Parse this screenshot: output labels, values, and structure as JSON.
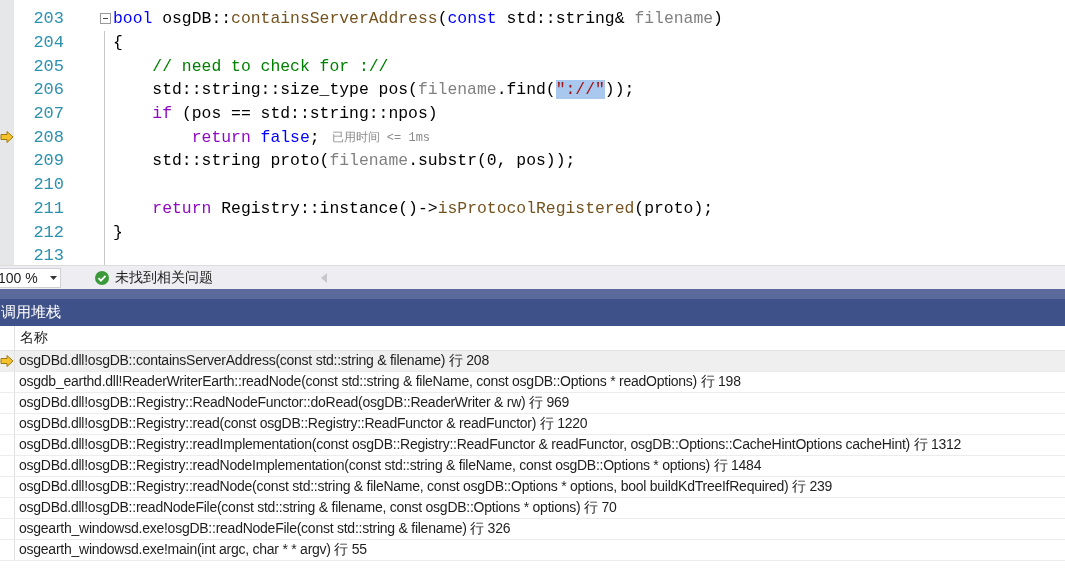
{
  "editor": {
    "lines": [
      {
        "number": "203",
        "current": false,
        "fold": true,
        "tokens": [
          {
            "kind": "kw",
            "text": "bool"
          },
          {
            "kind": "plain",
            "text": " osgDB::"
          },
          {
            "kind": "func",
            "text": "containsServerAddress"
          },
          {
            "kind": "plain",
            "text": "("
          },
          {
            "kind": "kw",
            "text": "const"
          },
          {
            "kind": "plain",
            "text": " std::string& "
          },
          {
            "kind": "param",
            "text": "filename"
          },
          {
            "kind": "plain",
            "text": ")"
          }
        ]
      },
      {
        "number": "204",
        "current": false,
        "tokens": [
          {
            "kind": "plain",
            "text": "{"
          }
        ]
      },
      {
        "children": [
          {
            "number": "205",
            "current": false,
            "tokens": [
              {
                "kind": "comment",
                "text": "// need to check for ://"
              }
            ]
          },
          {
            "number": "206",
            "current": false,
            "tokens": [
              {
                "kind": "plain",
                "text": "std::string::size_type pos("
              },
              {
                "kind": "param",
                "text": "filename"
              },
              {
                "kind": "plain",
                "text": ".find("
              },
              {
                "kind": "str",
                "text": "\"://\"",
                "highlighted": true
              },
              {
                "kind": "plain",
                "text": "));"
              }
            ]
          },
          {
            "number": "207",
            "current": false,
            "tokens": [
              {
                "kind": "flow",
                "text": "if"
              },
              {
                "kind": "plain",
                "text": " (pos == std::string::npos)"
              }
            ],
            "children": [
              {
                "number": "208",
                "current": true,
                "tokens": [
                  {
                    "kind": "flow",
                    "text": "return"
                  },
                  {
                    "kind": "kw",
                    "text": " false"
                  },
                  {
                    "kind": "plain",
                    "text": ";"
                  }
                ],
                "hint": "已用时间 <= 1ms"
              }
            ]
          },
          {
            "number": "209",
            "current": false,
            "tokens": [
              {
                "kind": "plain",
                "text": "std::string proto("
              },
              {
                "kind": "param",
                "text": "filename"
              },
              {
                "kind": "plain",
                "text": ".substr(0, pos));"
              }
            ]
          },
          {
            "number": "210",
            "current": false
          },
          {
            "number": "211",
            "current": false,
            "tokens": [
              {
                "kind": "flow",
                "text": "return"
              },
              {
                "kind": "plain",
                "text": " Registry::instance()->"
              },
              {
                "kind": "func",
                "text": "isProtocolRegistered"
              },
              {
                "kind": "plain",
                "text": "(proto);"
              }
            ]
          }
        ]
      },
      {
        "number": "212",
        "current": false,
        "tokens": [
          {
            "kind": "plain",
            "text": "}"
          }
        ]
      },
      {
        "number": "213",
        "current": false
      }
    ]
  },
  "status_strip": {
    "zoom": "100 %",
    "message": "未找到相关问题"
  },
  "call_stack": {
    "title": "调用堆栈",
    "columns": [
      "名称"
    ],
    "frames": [
      {
        "name": "osgDBd.dll!osgDB::containsServerAddress(const std::string & filename) 行 208",
        "current": true
      },
      {
        "name": "osgdb_earthd.dll!ReaderWriterEarth::readNode(const std::string & fileName, const osgDB::Options * readOptions) 行 198",
        "current": false
      },
      {
        "name": "osgDBd.dll!osgDB::Registry::ReadNodeFunctor::doRead(osgDB::ReaderWriter & rw) 行 969",
        "current": false
      },
      {
        "name": "osgDBd.dll!osgDB::Registry::read(const osgDB::Registry::ReadFunctor & readFunctor) 行 1220",
        "current": false
      },
      {
        "name": "osgDBd.dll!osgDB::Registry::readImplementation(const osgDB::Registry::ReadFunctor & readFunctor, osgDB::Options::CacheHintOptions cacheHint) 行 1312",
        "current": false
      },
      {
        "name": "osgDBd.dll!osgDB::Registry::readNodeImplementation(const std::string & fileName, const osgDB::Options * options) 行 1484",
        "current": false
      },
      {
        "name": "osgDBd.dll!osgDB::Registry::readNode(const std::string & fileName, const osgDB::Options * options, bool buildKdTreeIfRequired) 行 239",
        "current": false
      },
      {
        "name": "osgDBd.dll!osgDB::readNodeFile(const std::string & filename, const osgDB::Options * options) 行 70",
        "current": false
      },
      {
        "name": "osgearth_windowsd.exe!osgDB::readNodeFile(const std::string & filename) 行 326",
        "current": false
      },
      {
        "name": "osgearth_windowsd.exe!main(int argc, char * * argv) 行 55",
        "current": false
      }
    ]
  }
}
